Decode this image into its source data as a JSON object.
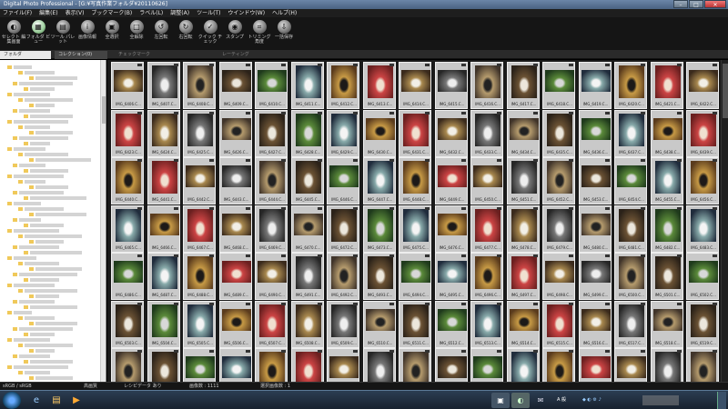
{
  "window": {
    "title": "Digital Photo Professional - [G:¥写真作業フォルダ¥20110626]"
  },
  "menu": [
    "ファイル(F)",
    "編集(E)",
    "表示(V)",
    "ブックマーク(B)",
    "ラベル(L)",
    "調整(A)",
    "ツール(T)",
    "ウインドウ(W)",
    "ヘルプ(H)"
  ],
  "toolbar": [
    {
      "label": "セレクト 編集画面",
      "icon": "select-edit-icon"
    },
    {
      "label": "フォルダ ビュー",
      "icon": "folder-view-icon"
    },
    {
      "label": "ツール パレット",
      "icon": "tool-palette-icon"
    },
    {
      "label": "画像情報",
      "icon": "info-icon"
    },
    {
      "label": "全選択",
      "icon": "select-all-icon"
    },
    {
      "label": "全解除",
      "icon": "deselect-icon"
    },
    {
      "label": "左回転",
      "icon": "rotate-left-icon"
    },
    {
      "label": "右回転",
      "icon": "rotate-right-icon"
    },
    {
      "label": "クイック チェック",
      "icon": "quick-check-icon"
    },
    {
      "label": "スタンプ",
      "icon": "stamp-icon"
    },
    {
      "label": "トリミング 角度",
      "icon": "trim-icon"
    },
    {
      "label": "一括保存",
      "icon": "batch-save-icon"
    }
  ],
  "tabs": {
    "folder": "フォルダ",
    "collection": "コレクション(0)",
    "check": "チェックマーク",
    "rating": "レーティング"
  },
  "grid": {
    "rows": [
      [
        "IMG_6406.C...",
        "IMG_6407.C...",
        "IMG_6408.C...",
        "IMG_6409.C...",
        "IMG_6410.C...",
        "IMG_6411.C...",
        "IMG_6412.C...",
        "IMG_6413.C...",
        "IMG_6414.C...",
        "IMG_6415.C...",
        "IMG_6416.C...",
        "IMG_6417.C...",
        "IMG_6418.C...",
        "IMG_6419.C...",
        "IMG_6420.C...",
        "IMG_6421.C...",
        "IMG_6422.C..."
      ],
      [
        "IMG_6423.C...",
        "IMG_6424.C...",
        "IMG_6425.C...",
        "IMG_6426.C...",
        "IMG_6427.C...",
        "IMG_6428.C...",
        "IMG_6429.C...",
        "IMG_6430.C...",
        "IMG_6431.C...",
        "IMG_6432.C...",
        "IMG_6433.C...",
        "IMG_6434.C...",
        "IMG_6435.C...",
        "IMG_6436.C...",
        "IMG_6437.C...",
        "IMG_6438.C...",
        "IMG_6439.C..."
      ],
      [
        "IMG_6440.C...",
        "IMG_6441.C...",
        "IMG_6442.C...",
        "IMG_6443.C...",
        "IMG_6444.C...",
        "IMG_6445.C...",
        "IMG_6446.C...",
        "IMG_6447.C...",
        "IMG_6448.C...",
        "IMG_6449.C...",
        "IMG_6450.C...",
        "IMG_6451.C...",
        "IMG_6452.C...",
        "IMG_6453.C...",
        "IMG_6454.C...",
        "IMG_6455.C...",
        "IMG_6456.C..."
      ],
      [
        "IMG_6465.C...",
        "IMG_6466.C...",
        "IMG_6467.C...",
        "IMG_6468.C...",
        "IMG_6469.C...",
        "IMG_6470.C...",
        "IMG_6472.C...",
        "IMG_6473.C...",
        "IMG_6475.C...",
        "IMG_6476.C...",
        "IMG_6477.C...",
        "IMG_6478.C...",
        "IMG_6479.C...",
        "IMG_6480.C...",
        "IMG_6481.C...",
        "IMG_6482.C...",
        "IMG_6483.C..."
      ],
      [
        "IMG_6486.C...",
        "IMG_6487.C...",
        "IMG_6488.C...",
        "IMG_6489.C...",
        "IMG_6490.C...",
        "IMG_6491.C...",
        "IMG_6492.C...",
        "IMG_6493.C...",
        "IMG_6494.C...",
        "IMG_6495.C...",
        "IMG_6496.C...",
        "IMG_6497.C...",
        "IMG_6498.C...",
        "IMG_6499.C...",
        "IMG_6500.C...",
        "IMG_6501.C...",
        "IMG_6502.C..."
      ],
      [
        "IMG_6503.C...",
        "IMG_6504.C...",
        "IMG_6505.C...",
        "IMG_6506.C...",
        "IMG_6507.C...",
        "IMG_6508.C...",
        "IMG_6509.C...",
        "IMG_6510.C...",
        "IMG_6511.C...",
        "IMG_6512.C...",
        "IMG_6513.C...",
        "IMG_6514.C...",
        "IMG_6515.C...",
        "IMG_6516.C...",
        "IMG_6517.C...",
        "IMG_6518.C...",
        "IMG_6519.C..."
      ],
      [
        "",
        "",
        "",
        "",
        "",
        "",
        "",
        "",
        "",
        "",
        "",
        "",
        "",
        "",
        "",
        "",
        ""
      ]
    ]
  },
  "status": {
    "colorspace": "sRGB / sRGB",
    "quality": "高画質",
    "recipe": "レシピデータ あり",
    "count": "画像数 : 1111",
    "selected": "選択画像数 : 1"
  },
  "taskbar": {
    "apps": [
      "explorer-icon",
      "ie-icon",
      "folder-icon",
      "media-player-icon",
      "photoshop-icon",
      "dpp-icon",
      "mail-icon"
    ],
    "tray_ime": "A 般"
  }
}
